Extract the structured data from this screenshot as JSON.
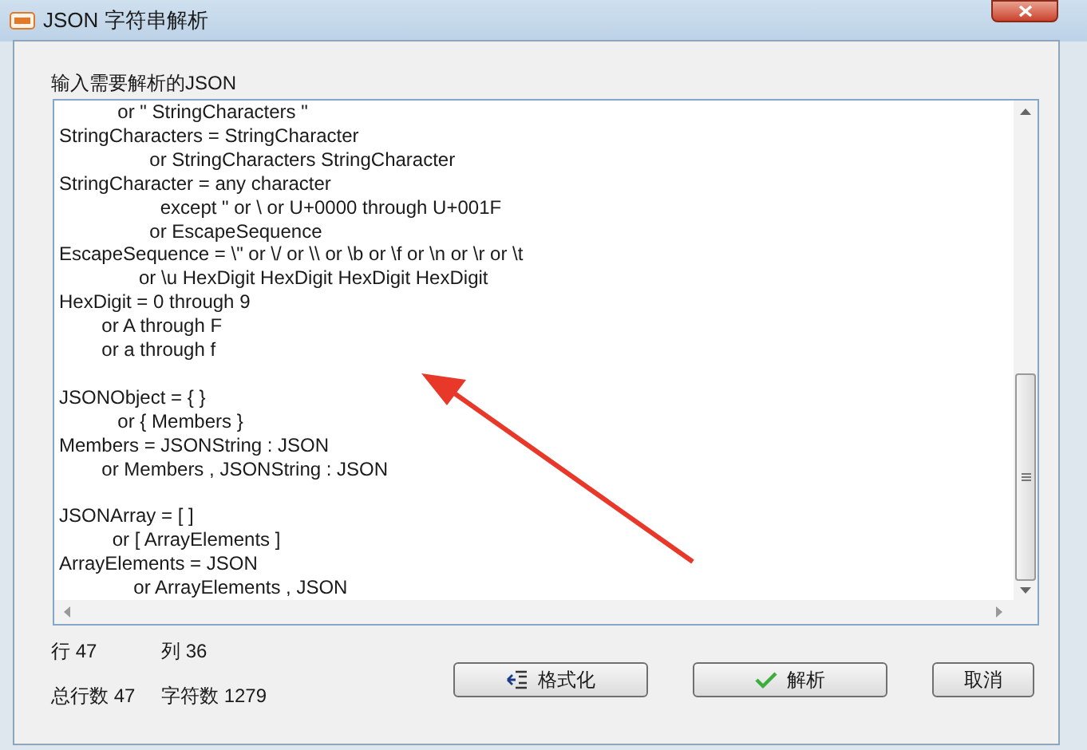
{
  "window": {
    "title": "JSON 字符串解析"
  },
  "input_label": "输入需要解析的JSON",
  "editor": {
    "blocks": [
      [
        "           or \" StringCharacters \"",
        "StringCharacters = StringCharacter",
        "                 or StringCharacters StringCharacter",
        "StringCharacter = any character",
        "                   except \" or \\ or U+0000 through U+001F",
        "                 or EscapeSequence",
        "EscapeSequence = \\\" or \\/ or \\\\ or \\b or \\f or \\n or \\r or \\t",
        "               or \\u HexDigit HexDigit HexDigit HexDigit",
        "HexDigit = 0 through 9",
        "        or A through F",
        "        or a through f"
      ],
      [
        "JSONObject = { }",
        "           or { Members }",
        "Members = JSONString : JSON",
        "        or Members , JSONString : JSON"
      ],
      [
        "JSONArray = [ ]",
        "          or [ ArrayElements ]",
        "ArrayElements = JSON",
        "              or ArrayElements , JSON"
      ]
    ]
  },
  "status": [
    {
      "label": "行 47"
    },
    {
      "label": "列 36"
    },
    {
      "label": "总行数 47"
    },
    {
      "label": "字符数 1279"
    }
  ],
  "buttons": [
    {
      "label": "格式化",
      "kind": "format"
    },
    {
      "label": "解析",
      "kind": "parse"
    },
    {
      "label": "取消",
      "kind": "cancel"
    }
  ]
}
